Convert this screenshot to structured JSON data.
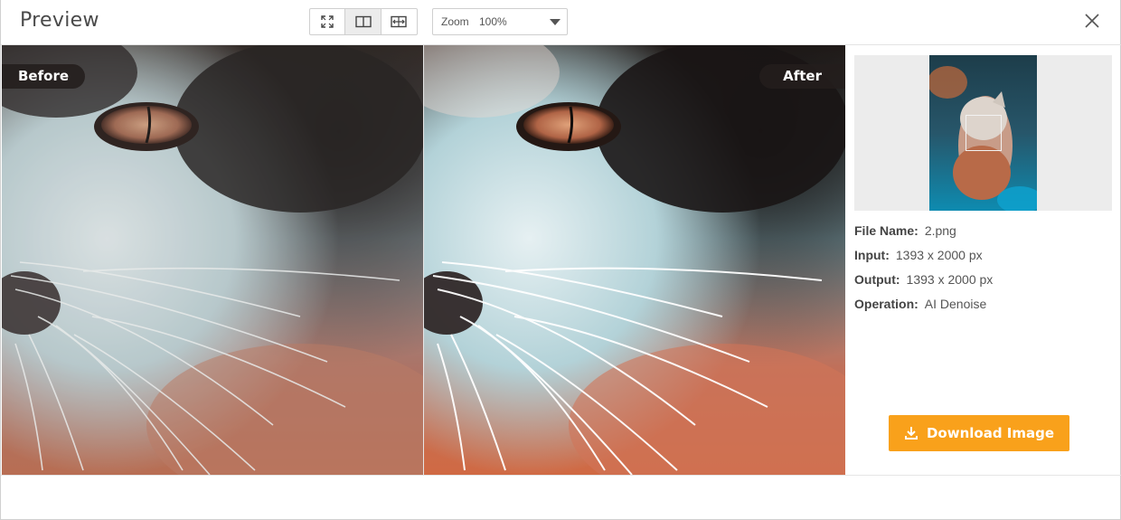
{
  "header": {
    "title": "Preview",
    "view_modes": [
      {
        "name": "fit-screen",
        "icon": "expand-icon",
        "active": false
      },
      {
        "name": "split-view",
        "icon": "split-view-icon",
        "active": true
      },
      {
        "name": "compare-slider",
        "icon": "compare-slider-icon",
        "active": false
      }
    ],
    "zoom_label": "Zoom",
    "zoom_value": "100%"
  },
  "compare": {
    "before_label": "Before",
    "after_label": "After"
  },
  "info": {
    "file_name_label": "File Name:",
    "file_name": "2.png",
    "input_label": "Input:",
    "input_value": "1393 x 2000 px",
    "output_label": "Output:",
    "output_value": "1393 x 2000 px",
    "operation_label": "Operation:",
    "operation_value": "AI Denoise"
  },
  "download_label": "Download Image",
  "colors": {
    "accent": "#f9a11b",
    "tag_bg": "#231e1c"
  }
}
